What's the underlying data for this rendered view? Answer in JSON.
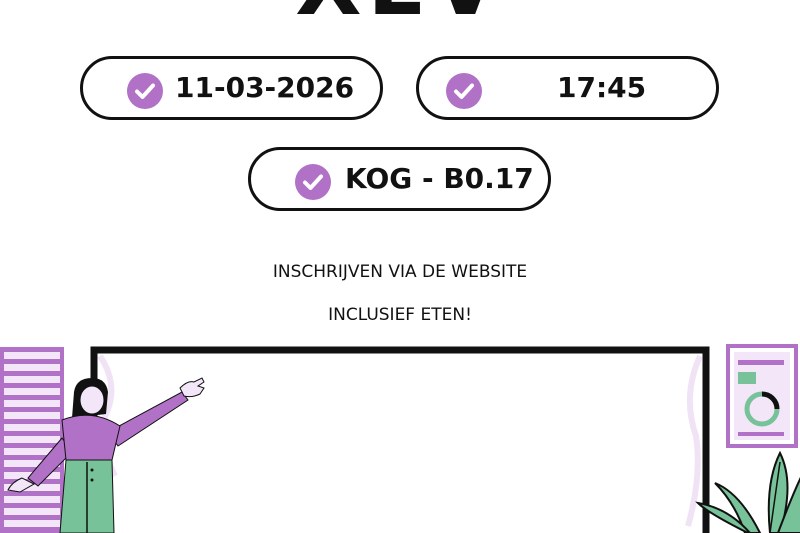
{
  "header": {
    "title_partial": "XEV"
  },
  "event": {
    "date": "11-03-2026",
    "time": "17:45",
    "location": "KOG - B0.17"
  },
  "info": {
    "line1": "INSCHRIJVEN VIA DE WEBSITE",
    "line2": "INCLUSIEF ETEN!"
  },
  "colors": {
    "accent_purple": "#b071c6",
    "light_purple": "#e3c9ef",
    "green": "#77c298",
    "ink": "#111111"
  },
  "icons": [
    "check-circle-icon",
    "presenter-illustration",
    "chart-poster-illustration",
    "plant-illustration",
    "window-blind-illustration"
  ]
}
